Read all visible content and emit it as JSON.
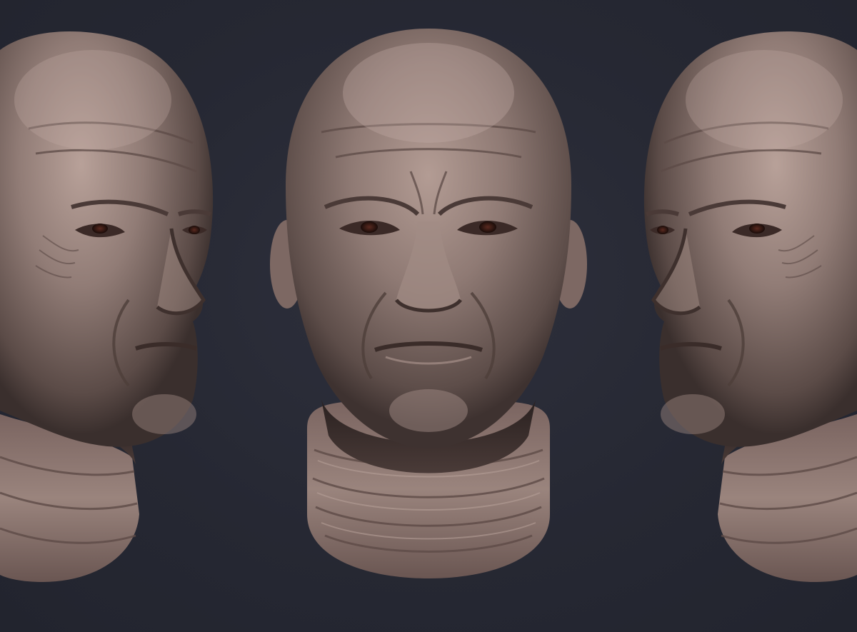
{
  "scene": {
    "background_color": "#262833",
    "material_color": "#8a7570",
    "highlight_color": "#c8b2aa",
    "shadow_color": "#3a302e",
    "eye_color": "#3a1a14",
    "views": [
      {
        "name": "three-quarter-left"
      },
      {
        "name": "front"
      },
      {
        "name": "three-quarter-right"
      }
    ]
  }
}
